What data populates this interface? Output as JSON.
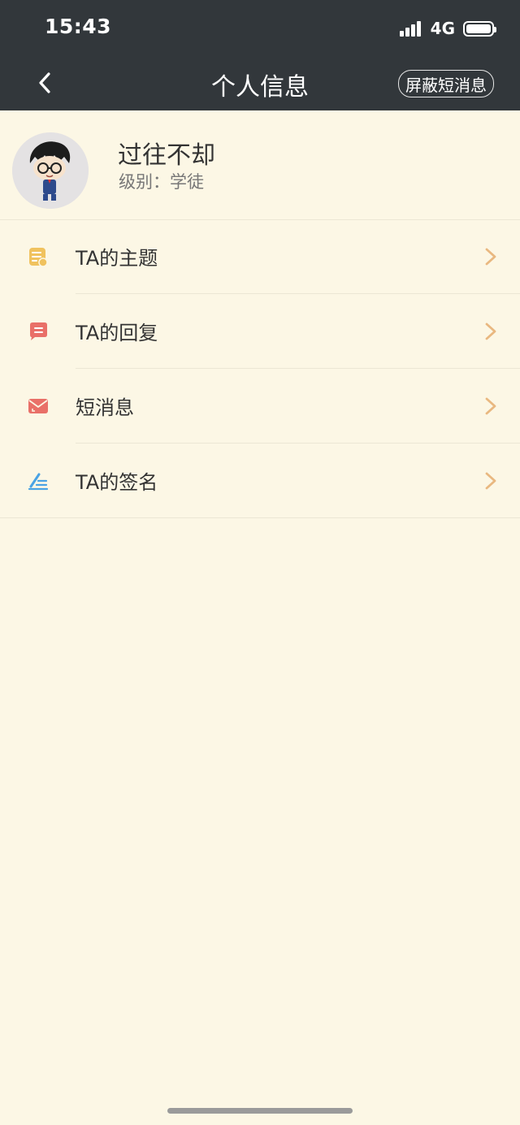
{
  "status_bar": {
    "time": "15:43",
    "network": "4G"
  },
  "header": {
    "title": "个人信息",
    "block_label": "屏蔽短消息"
  },
  "profile": {
    "username": "过往不却",
    "level": "级别：学徒"
  },
  "menu": {
    "items": [
      {
        "label": "TA的主题",
        "icon": "topic-icon",
        "color": "#f0c25e"
      },
      {
        "label": "TA的回复",
        "icon": "reply-icon",
        "color": "#e97068"
      },
      {
        "label": "短消息",
        "icon": "mail-icon",
        "color": "#e97068"
      },
      {
        "label": "TA的签名",
        "icon": "signature-icon",
        "color": "#4aa3e4"
      }
    ]
  },
  "colors": {
    "header_bg": "#32373b",
    "page_bg": "#fcf7e5",
    "chevron": "#e9b880"
  }
}
